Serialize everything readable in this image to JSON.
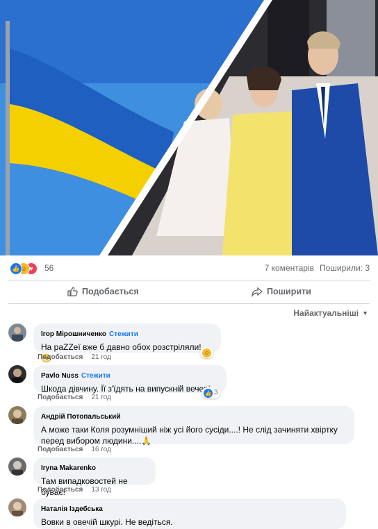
{
  "post": {
    "reactions_count": "56",
    "comments_label": "7 коментарів",
    "shares_label": "Поширили: 3",
    "like_label": "Подобається",
    "share_label": "Поширити",
    "sort_label": "Найактуальніші"
  },
  "comments": [
    {
      "author": "Ігор Мірошниченко",
      "follow": "Стежити",
      "text": "На раZZеї вже б давно обох розстріляли!",
      "like": "Подобається",
      "time": "21 год"
    },
    {
      "author": "Pavlo Nuss",
      "follow": "Стежити",
      "text": "Шкода дівчину. Її з'їдять на випускній вечері.",
      "like": "Подобається",
      "time": "21 год",
      "reactions": "3"
    },
    {
      "author": "Андрій Потопальський",
      "text_line1": "А може таки Коля розумніший ніж усі його сусіди....! Не слід зачиняти хвіртку",
      "text_line2": "перед вибором людини....🙏",
      "like": "Подобається",
      "time": "16 год"
    },
    {
      "author": "Iryna Makarenko",
      "text": "Там випадковостей не буває!",
      "like": "Подобається",
      "time": "13 год"
    },
    {
      "author": "Наталія Іздебська",
      "text": "Вовки в овечій шкурі. Не ведіться."
    }
  ],
  "colors": {
    "accent": "#1877f2",
    "flag_blue": "#1f5fbf",
    "flag_yellow": "#f5d000",
    "bubble": "#f0f2f5"
  }
}
